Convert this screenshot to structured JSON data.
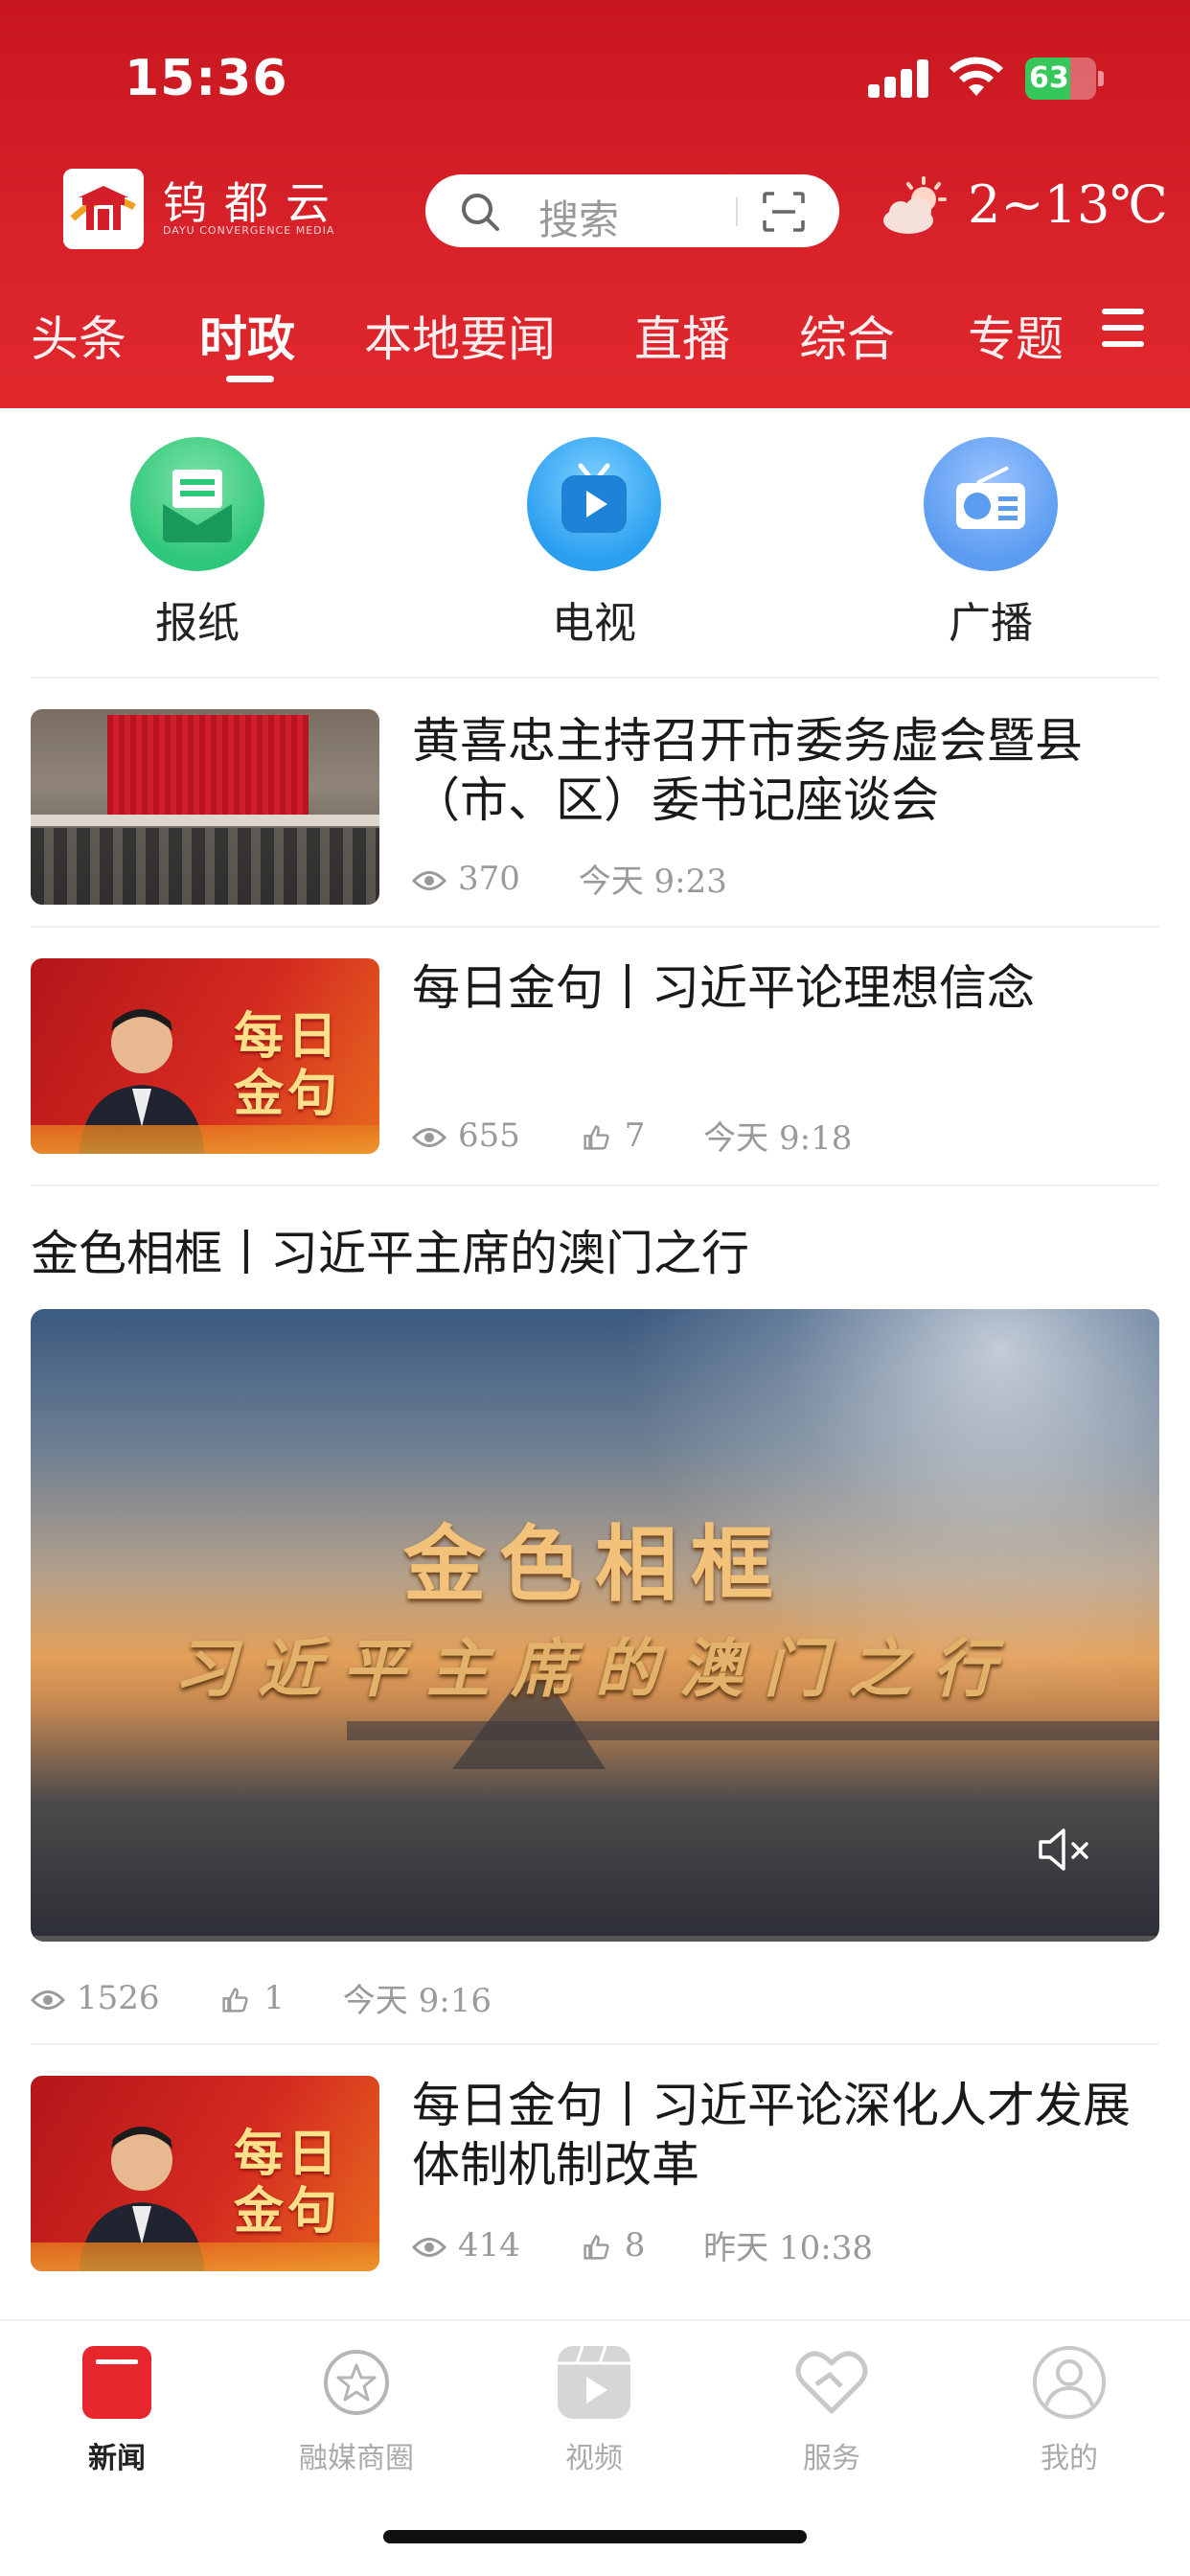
{
  "status_bar": {
    "time": "15:36",
    "battery": "63",
    "battery_level": 0.63
  },
  "app": {
    "name": "钨都云",
    "subtitle": "DAYU CONVERGENCE MEDIA"
  },
  "search": {
    "placeholder": "搜索"
  },
  "weather": {
    "temp": "2~13℃",
    "icon": "partly-cloudy-icon"
  },
  "nav": {
    "tabs": [
      {
        "label": "头条"
      },
      {
        "label": "时政",
        "active": true
      },
      {
        "label": "本地要闻"
      },
      {
        "label": "直播"
      },
      {
        "label": "综合"
      },
      {
        "label": "专题"
      }
    ]
  },
  "quick": [
    {
      "label": "报纸",
      "icon": "newspaper-icon",
      "color": "#2fc77a"
    },
    {
      "label": "电视",
      "icon": "tv-icon",
      "color": "#2a9ff0"
    },
    {
      "label": "广播",
      "icon": "radio-icon",
      "color": "#5b9cf0"
    }
  ],
  "news": [
    {
      "title": "黄喜忠主持召开市委务虚会暨县（市、区）委书记座谈会",
      "views": "370",
      "time": "今天  9:23"
    },
    {
      "title": "每日金句丨习近平论理想信念",
      "views": "655",
      "likes": "7",
      "time": "今天  9:18",
      "thumb_text": "每日\n金句"
    },
    {
      "title": "金色相框丨习近平主席的澳门之行",
      "video_title1": "金色相框",
      "video_title2": "习近平主席的澳门之行",
      "views": "1526",
      "likes": "1",
      "time": "今天  9:16"
    },
    {
      "title": "每日金句丨习近平论深化人才发展体制机制改革",
      "views": "414",
      "likes": "8",
      "time": "昨天  10:38",
      "thumb_text": "每日\n金句"
    }
  ],
  "tabbar": [
    {
      "label": "新闻",
      "active": true,
      "icon": "news-icon"
    },
    {
      "label": "融媒商圈",
      "icon": "star-circle-icon"
    },
    {
      "label": "视频",
      "icon": "video-icon"
    },
    {
      "label": "服务",
      "icon": "heart-hand-icon"
    },
    {
      "label": "我的",
      "icon": "profile-icon"
    }
  ],
  "colors": {
    "brand_red": "#d9222a",
    "active_tab": "#e8262d"
  }
}
